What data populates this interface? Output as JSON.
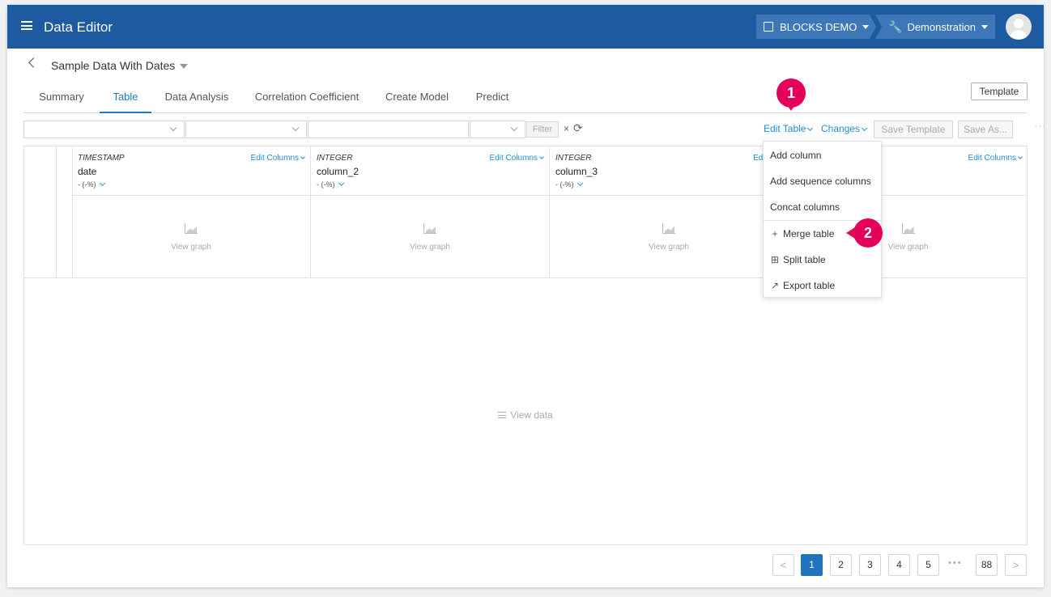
{
  "appbar": {
    "title": "Data Editor",
    "org_label": "BLOCKS DEMO",
    "project_label": "Demonstration",
    "org_icon": "building-icon",
    "project_icon": "wrench-icon"
  },
  "dataset": {
    "name": "Sample Data With Dates"
  },
  "tabs": [
    {
      "label": "Summary"
    },
    {
      "label": "Table"
    },
    {
      "label": "Data Analysis"
    },
    {
      "label": "Correlation Coefficient"
    },
    {
      "label": "Create Model"
    },
    {
      "label": "Predict"
    }
  ],
  "template_button": "Template",
  "toolbar": {
    "filter_label": "Filter",
    "clear_label": "×",
    "edit_table_label": "Edit Table",
    "changes_label": "Changes",
    "save_template_label": "Save Template",
    "save_as_label": "Save As...",
    "more_label": "···"
  },
  "columns": [
    {
      "type": "TIMESTAMP",
      "name": "date",
      "pct": "- (-%)",
      "edit_label": "Edit Columns",
      "graph_label": "View graph"
    },
    {
      "type": "INTEGER",
      "name": "column_2",
      "pct": "- (-%)",
      "edit_label": "Edit Columns",
      "graph_label": "View graph"
    },
    {
      "type": "INTEGER",
      "name": "column_3",
      "pct": "- (-%)",
      "edit_label": "Edit Colum",
      "graph_label": "View graph"
    },
    {
      "type": "",
      "name": "",
      "pct": "",
      "edit_label": "Edit Columns",
      "graph_label": "View graph"
    }
  ],
  "view_data_label": "View data",
  "edit_table_menu": {
    "items": [
      {
        "label": "Add column",
        "icon": ""
      },
      {
        "label": "Add sequence columns",
        "icon": ""
      },
      {
        "label": "Concat columns",
        "icon": ""
      },
      {
        "label": "Merge table",
        "icon": "plus-icon",
        "glyph": "+"
      },
      {
        "label": "Split table",
        "icon": "grid-icon",
        "glyph": "⊞"
      },
      {
        "label": "Export table",
        "icon": "export-icon",
        "glyph": "↗"
      }
    ]
  },
  "callouts": {
    "step1": "1",
    "step2": "2"
  },
  "pagination": {
    "prev": "<",
    "next": ">",
    "pages": [
      "1",
      "2",
      "3",
      "4",
      "5"
    ],
    "ellipsis": "•••",
    "last": "88",
    "current": "1"
  },
  "colors": {
    "appbar": "#1e5aa0",
    "accent": "#1f7ac4",
    "callout": "#e5005a"
  }
}
